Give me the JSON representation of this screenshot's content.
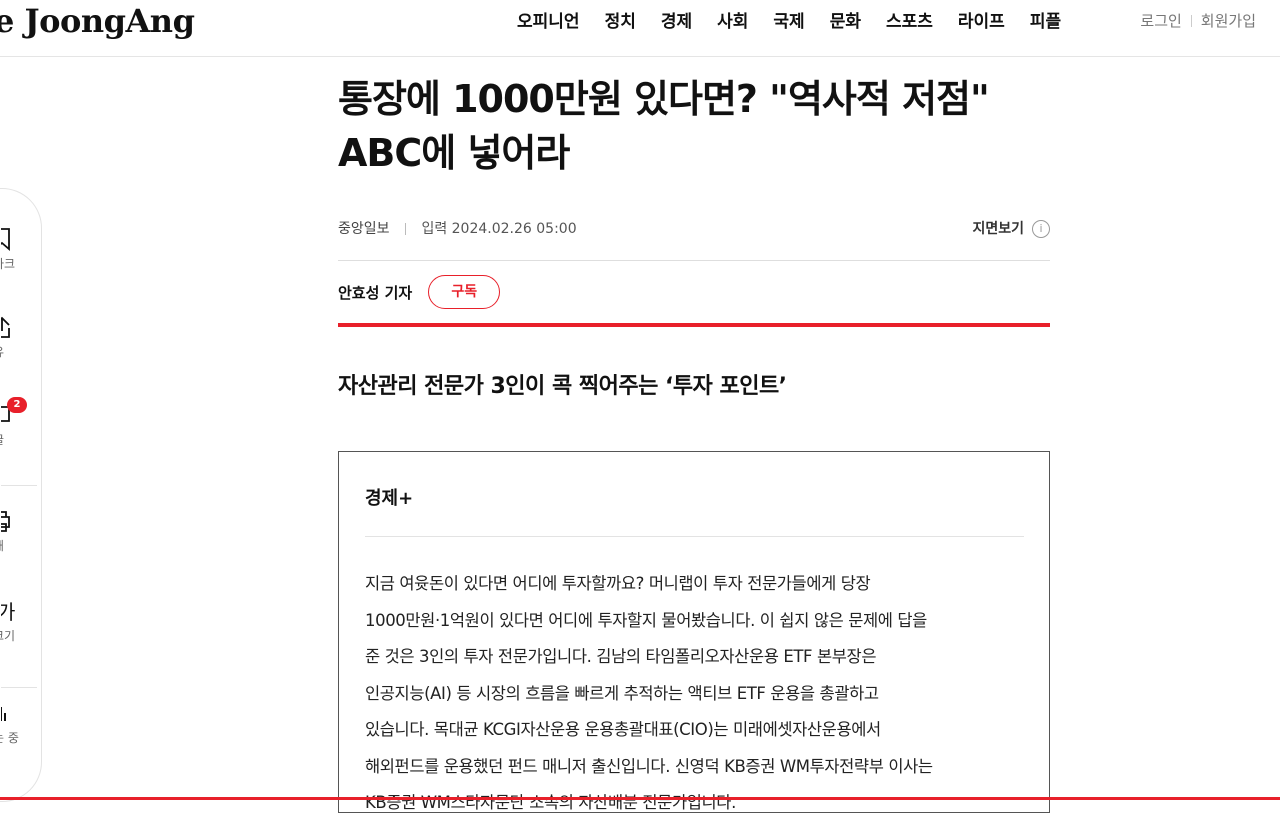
{
  "header": {
    "logo": "e JoongAng",
    "nav": [
      "오피니언",
      "정치",
      "경제",
      "사회",
      "국제",
      "문화",
      "스포츠",
      "라이프",
      "피플"
    ],
    "login": "로그인",
    "signup": "회원가입"
  },
  "sidebar": {
    "items": [
      {
        "icon": "bookmark-icon",
        "label": "마크"
      },
      {
        "icon": "share-icon",
        "label": "유"
      },
      {
        "icon": "comment-icon",
        "label": "글",
        "badge": "2"
      },
      {
        "icon": "print-icon",
        "label": "쇄"
      },
      {
        "icon": "font-size-icon",
        "label": "크기"
      },
      {
        "icon": "tts-icon",
        "label": "는 중"
      }
    ]
  },
  "article": {
    "headline_line1": "통장에 1000만원 있다면? \"역사적 저점\"",
    "headline_line2": "ABC에 넣어라",
    "source": "중앙일보",
    "date": "입력 2024.02.26 05:00",
    "print_view": "지면보기",
    "reporter": "안효성 기자",
    "subscribe": "구독",
    "subheadline": "자산관리 전문가 3인이 콕 찍어주는 ‘투자 포인트’"
  },
  "box": {
    "title": "경제+",
    "lines": [
      "지금 여윳돈이 있다면 어디에 투자할까요? 머니랩이 투자 전문가들에게 당장",
      "1000만원·1억원이 있다면 어디에 투자할지 물어봤습니다. 이 쉽지 않은 문제에 답을",
      "준 것은 3인의 투자 전문가입니다. 김남의 타임폴리오자산운용 ETF 본부장은",
      "인공지능(AI) 등 시장의 흐름을 빠르게 추적하는 액티브 ETF 운용을 총괄하고",
      "있습니다. 목대균 KCGI자산운용 운용총괄대표(CIO)는 미래에셋자산운용에서",
      "해외펀드를 운용했던 펀드 매니저 출신입니다. 신영덕 KB증권 WM투자전략부 이사는",
      "KB증권 WM스타자문단 소속의 자산배분 전문가입니다."
    ]
  },
  "colors": {
    "accent": "#e8202a",
    "text": "#111111"
  }
}
